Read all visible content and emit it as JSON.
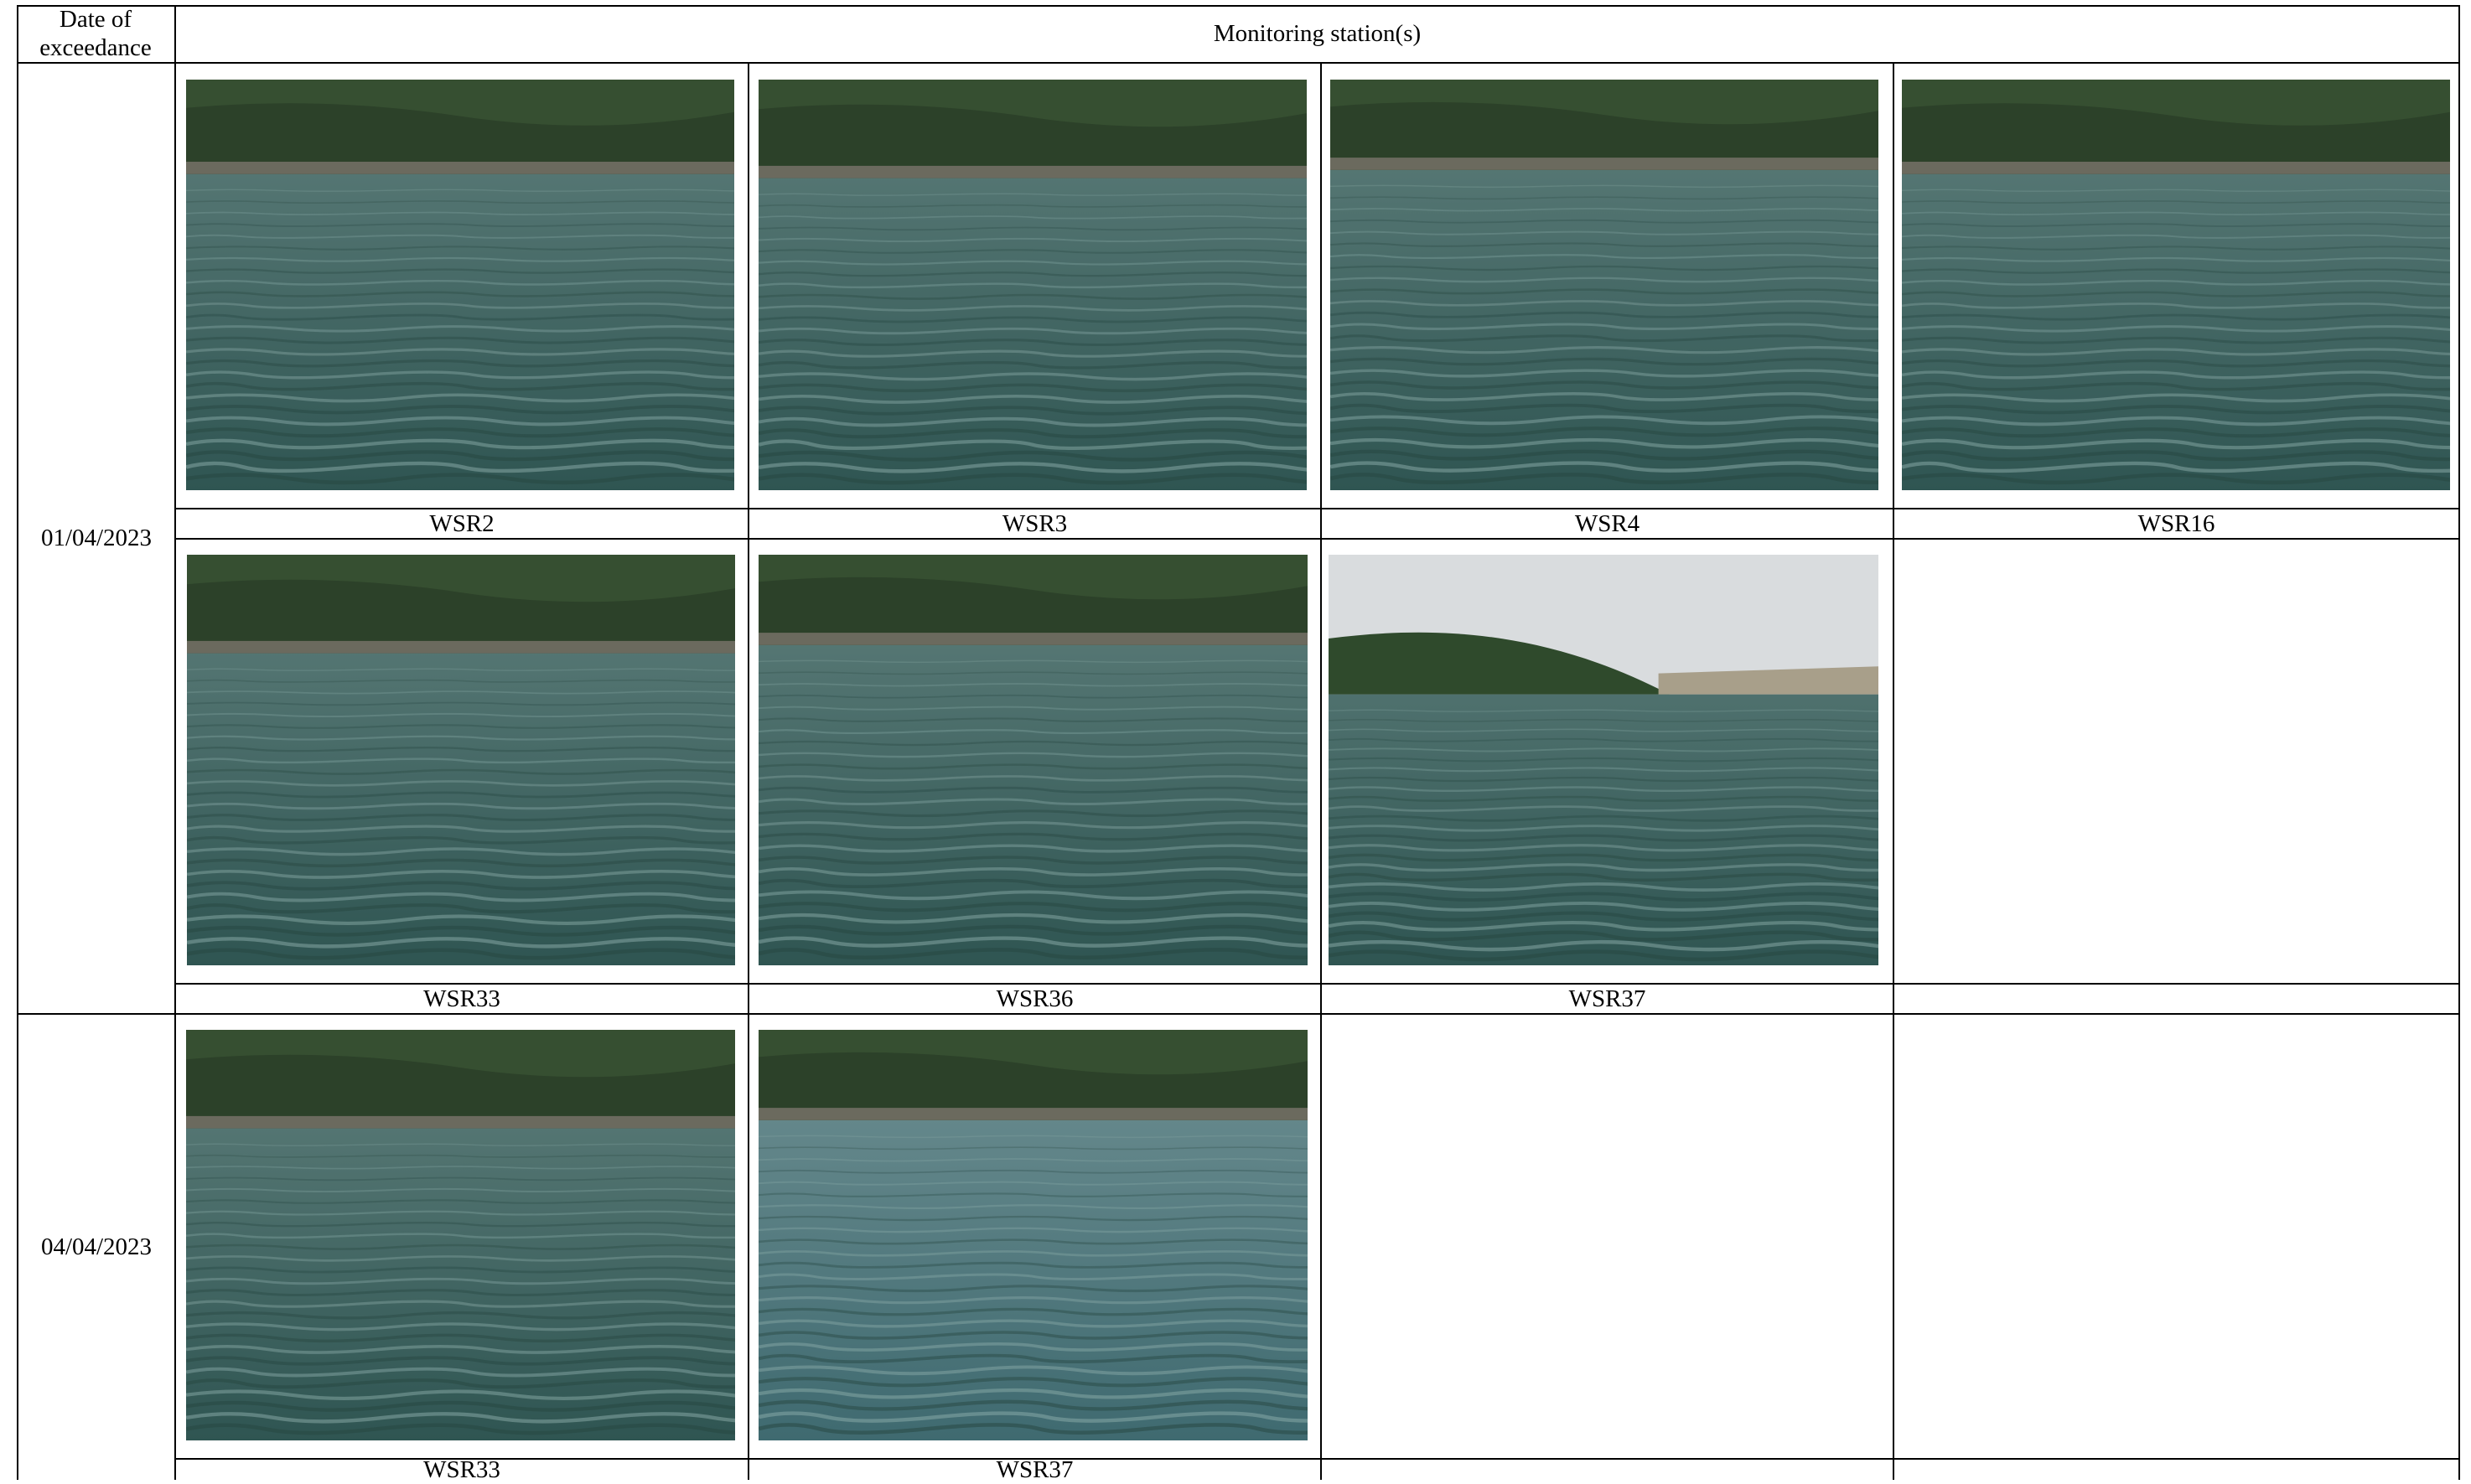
{
  "header": {
    "date_label": "Date of exceedance",
    "stations_label": "Monitoring station(s)"
  },
  "groups": [
    {
      "date": "01/04/2023",
      "rows": [
        [
          "WSR2",
          "WSR3",
          "WSR4",
          "WSR16"
        ],
        [
          "WSR33",
          "WSR36",
          "WSR37",
          ""
        ]
      ]
    },
    {
      "date": "04/04/2023",
      "rows": [
        [
          "WSR33",
          "WSR37",
          "",
          ""
        ]
      ]
    }
  ],
  "photo_description": "Photo of sea surface at monitoring station with vegetated coastline in background"
}
